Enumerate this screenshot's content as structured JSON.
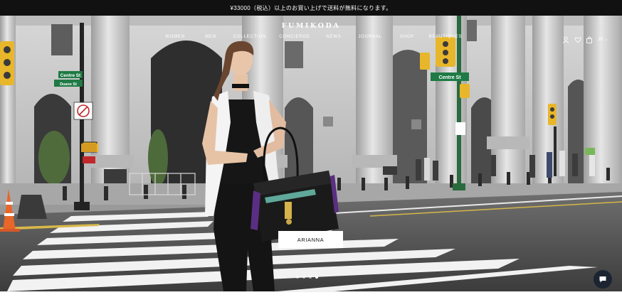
{
  "announcement": {
    "text": "¥33000（税込）以上のお買い上げで送料が無料になります。"
  },
  "header": {
    "logo": "FUMIKODA",
    "nav": [
      {
        "label": "WOMEN"
      },
      {
        "label": "MEN"
      },
      {
        "label": "COLLECTION"
      },
      {
        "label": "CONCIERGE"
      },
      {
        "label": "NEWS"
      },
      {
        "label": "JOURNAL"
      },
      {
        "label": "SHOP"
      },
      {
        "label": "BEAUTIQUES"
      }
    ],
    "icons": [
      "account-icon",
      "wishlist-heart-icon",
      "bag-icon"
    ],
    "language": "JP"
  },
  "hero": {
    "signs": {
      "street_upper": "Centre St",
      "street_lower": "Duane St",
      "street_right": "Centre St"
    },
    "cta_label": "ARIANNA",
    "slides_total": 4,
    "active_slide": 4
  },
  "colors": {
    "announcement_bg": "#111111",
    "chat_bg": "#1b2430"
  }
}
